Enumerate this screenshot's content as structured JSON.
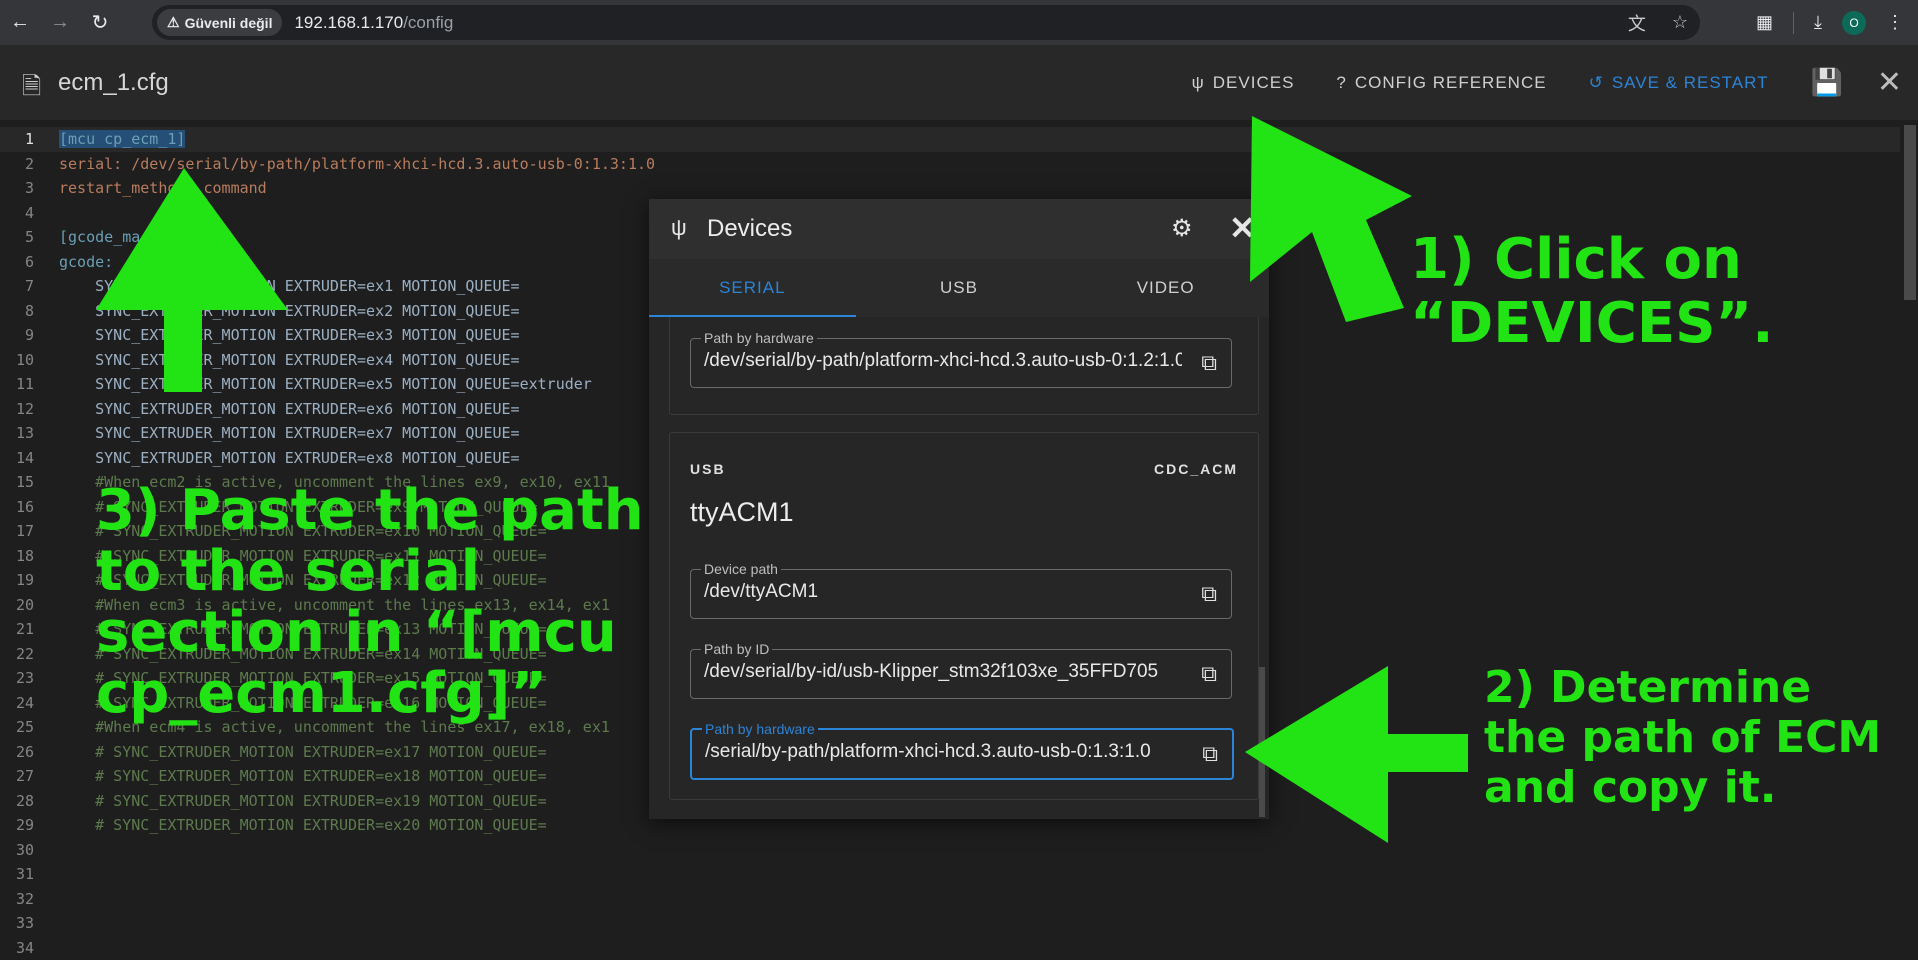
{
  "browser": {
    "security_label": "Güvenli değil",
    "url_host": "192.168.1.170",
    "url_path": "/config",
    "profile_initial": "O"
  },
  "header": {
    "file_name": "ecm_1.cfg",
    "devices_label": "DEVICES",
    "config_reference_label": "CONFIG REFERENCE",
    "save_restart_label": "SAVE & RESTART"
  },
  "editor": {
    "lines": [
      {
        "n": "1",
        "text": "[mcu cp_ecm_1]",
        "cls": "c-sec sel"
      },
      {
        "n": "2",
        "text": "serial: /dev/serial/by-path/platform-xhci-hcd.3.auto-usb-0:1.3:1.0",
        "cls": "c-val"
      },
      {
        "n": "3",
        "text": "restart_method: command",
        "cls": "c-val"
      },
      {
        "n": "4",
        "text": "",
        "cls": "c-norm"
      },
      {
        "n": "5",
        "text": "[gcode_macro",
        "cls": "c-sec"
      },
      {
        "n": "6",
        "text": "gcode:",
        "cls": "c-key"
      },
      {
        "n": "7",
        "text": "    SYNC_EXTRUDER_MOTION EXTRUDER=ex1 MOTION_QUEUE=",
        "cls": "c-norm"
      },
      {
        "n": "8",
        "text": "    SYNC_EXTRUDER_MOTION EXTRUDER=ex2 MOTION_QUEUE=",
        "cls": "c-norm"
      },
      {
        "n": "9",
        "text": "    SYNC_EXTRUDER_MOTION EXTRUDER=ex3 MOTION_QUEUE=",
        "cls": "c-norm"
      },
      {
        "n": "10",
        "text": "    SYNC_EXTRUDER_MOTION EXTRUDER=ex4 MOTION_QUEUE=",
        "cls": "c-norm"
      },
      {
        "n": "11",
        "text": "    SYNC_EXTRUDER_MOTION EXTRUDER=ex5 MOTION_QUEUE=extruder",
        "cls": "c-norm"
      },
      {
        "n": "12",
        "text": "    SYNC_EXTRUDER_MOTION EXTRUDER=ex6 MOTION_QUEUE=",
        "cls": "c-norm"
      },
      {
        "n": "13",
        "text": "    SYNC_EXTRUDER_MOTION EXTRUDER=ex7 MOTION_QUEUE=",
        "cls": "c-norm"
      },
      {
        "n": "14",
        "text": "    SYNC_EXTRUDER_MOTION EXTRUDER=ex8 MOTION_QUEUE=",
        "cls": "c-norm"
      },
      {
        "n": "15",
        "text": "    #When ecm2 is active, uncomment the lines ex9, ex10, ex11",
        "cls": "c-com"
      },
      {
        "n": "16",
        "text": "    # SYNC_EXTRUDER_MOTION EXTRUDER=ex9 MOTION_QUEUE=",
        "cls": "c-com"
      },
      {
        "n": "17",
        "text": "    # SYNC_EXTRUDER_MOTION EXTRUDER=ex10 MOTION_QUEUE=",
        "cls": "c-com"
      },
      {
        "n": "18",
        "text": "    # SYNC_EXTRUDER_MOTION EXTRUDER=ex11 MOTION_QUEUE=",
        "cls": "c-com"
      },
      {
        "n": "19",
        "text": "    # SYNC_EXTRUDER_MOTION EXTRUDER=ex12 MOTION_QUEUE=",
        "cls": "c-com"
      },
      {
        "n": "20",
        "text": "    #When ecm3 is active, uncomment the lines ex13, ex14, ex1",
        "cls": "c-com"
      },
      {
        "n": "21",
        "text": "    # SYNC_EXTRUDER_MOTION EXTRUDER=ex13 MOTION_QUEUE=",
        "cls": "c-com"
      },
      {
        "n": "22",
        "text": "    # SYNC_EXTRUDER_MOTION EXTRUDER=ex14 MOTION_QUEUE=",
        "cls": "c-com"
      },
      {
        "n": "23",
        "text": "    # SYNC_EXTRUDER_MOTION EXTRUDER=ex15 MOTION_QUEUE=",
        "cls": "c-com"
      },
      {
        "n": "24",
        "text": "    # SYNC_EXTRUDER_MOTION EXTRUDER=ex16 MOTION_QUEUE=",
        "cls": "c-com"
      },
      {
        "n": "25",
        "text": "    #When ecm4 is active, uncomment the lines ex17, ex18, ex1",
        "cls": "c-com"
      },
      {
        "n": "26",
        "text": "    # SYNC_EXTRUDER_MOTION EXTRUDER=ex17 MOTION_QUEUE=",
        "cls": "c-com"
      },
      {
        "n": "27",
        "text": "    # SYNC_EXTRUDER_MOTION EXTRUDER=ex18 MOTION_QUEUE=",
        "cls": "c-com"
      },
      {
        "n": "28",
        "text": "    # SYNC_EXTRUDER_MOTION EXTRUDER=ex19 MOTION_QUEUE=",
        "cls": "c-com"
      },
      {
        "n": "29",
        "text": "    # SYNC_EXTRUDER_MOTION EXTRUDER=ex20 MOTION_QUEUE=",
        "cls": "c-com"
      },
      {
        "n": "30",
        "text": "",
        "cls": "c-norm"
      },
      {
        "n": "31",
        "text": "",
        "cls": "c-norm"
      },
      {
        "n": "32",
        "text": "",
        "cls": "c-norm"
      },
      {
        "n": "33",
        "text": "",
        "cls": "c-norm"
      },
      {
        "n": "34",
        "text": "",
        "cls": "c-norm"
      }
    ]
  },
  "devices_dialog": {
    "title": "Devices",
    "tabs": [
      "SERIAL",
      "USB",
      "VIDEO"
    ],
    "active_tab": "SERIAL",
    "top_field": {
      "label": "Path by hardware",
      "value": "/dev/serial/by-path/platform-xhci-hcd.3.auto-usb-0:1.2:1.0"
    },
    "device": {
      "bus": "USB",
      "driver": "CDC_ACM",
      "name": "ttyACM1",
      "device_path_label": "Device path",
      "device_path": "/dev/ttyACM1",
      "path_by_id_label": "Path by ID",
      "path_by_id": "/dev/serial/by-id/usb-Klipper_stm32f103xe_35FFD705",
      "path_by_hardware_label": "Path by hardware",
      "path_by_hardware": "/serial/by-path/platform-xhci-hcd.3.auto-usb-0:1.3:1.0"
    }
  },
  "annotations": {
    "step1": "1) Click on “DEVICES”.",
    "step2": "2) Determine the path of ECM and copy it.",
    "step3": "3) Paste the path to the serial section in “[mcu cp_ecm1.cfg]”",
    "arrow_color": "#22e414"
  }
}
